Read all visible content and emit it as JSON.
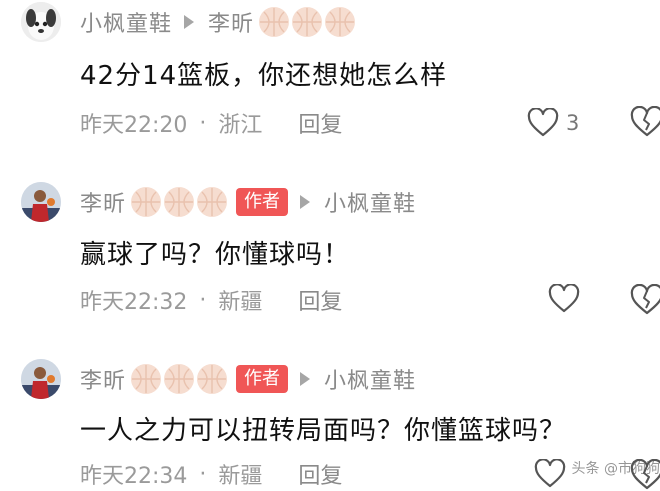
{
  "comments": [
    {
      "username": "小枫童鞋",
      "reply_to": "李昕",
      "text": "42分14篮板，你还想她怎么样",
      "time": "昨天22:20",
      "location": "浙江",
      "reply_label": "回复",
      "likes": "3"
    },
    {
      "username": "李昕",
      "author_tag": "作者",
      "reply_to": "小枫童鞋",
      "text": "赢球了吗？你懂球吗！",
      "time": "昨天22:32",
      "location": "新疆",
      "reply_label": "回复"
    },
    {
      "username": "李昕",
      "author_tag": "作者",
      "reply_to": "小枫童鞋",
      "text": "一人之力可以扭转局面吗？你懂篮球吗？",
      "time": "昨天22:34",
      "location": "新疆",
      "reply_label": "回复"
    }
  ],
  "watermark": "头条 @市狗狗",
  "colors": {
    "author_tag": "#f05656",
    "meta": "#9a9a9a",
    "badge": "#f6ddd0"
  },
  "icons": [
    "heart-icon",
    "broken-heart-icon",
    "reply-arrow-icon",
    "basketball-badge-icon"
  ]
}
